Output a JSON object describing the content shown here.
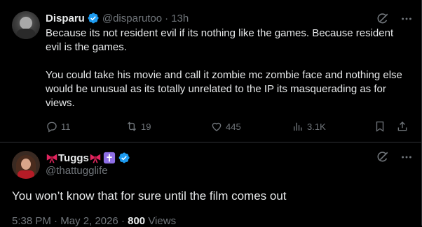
{
  "tweet1": {
    "author_name": "Disparu",
    "author_handle": "@disparutoo",
    "separator": "·",
    "time": "13h",
    "text_p1": "Because its not resident evil if its nothing like the games. Because resident evil is the games.",
    "text_p2": "You could take his movie and call it zombie mc zombie face and nothing else would be unusual as its totally unrelated to the IP its masquerading as for views.",
    "replies": "11",
    "reposts": "19",
    "likes": "445",
    "views": "3.1K"
  },
  "tweet2": {
    "author_name": "Tuggs",
    "author_handle": "@thattugglife",
    "text": "You won’t know that for sure until the film comes out",
    "time": "5:38 PM",
    "separator": "·",
    "date": "May 2, 2026",
    "views_count": "800",
    "views_label": "Views"
  },
  "colors": {
    "background": "#000000",
    "text_primary": "#e7e9ea",
    "text_secondary": "#71767b",
    "verified_blue": "#1d9bf0",
    "bow_red": "#e0245e",
    "cross_purple": "#8e6ee6",
    "divider": "#2f3336"
  },
  "icons": [
    "verified-badge-icon",
    "grok-icon",
    "more-icon",
    "reply-icon",
    "repost-icon",
    "like-icon",
    "views-icon",
    "bookmark-icon",
    "share-icon",
    "bow-icon",
    "cross-icon"
  ]
}
